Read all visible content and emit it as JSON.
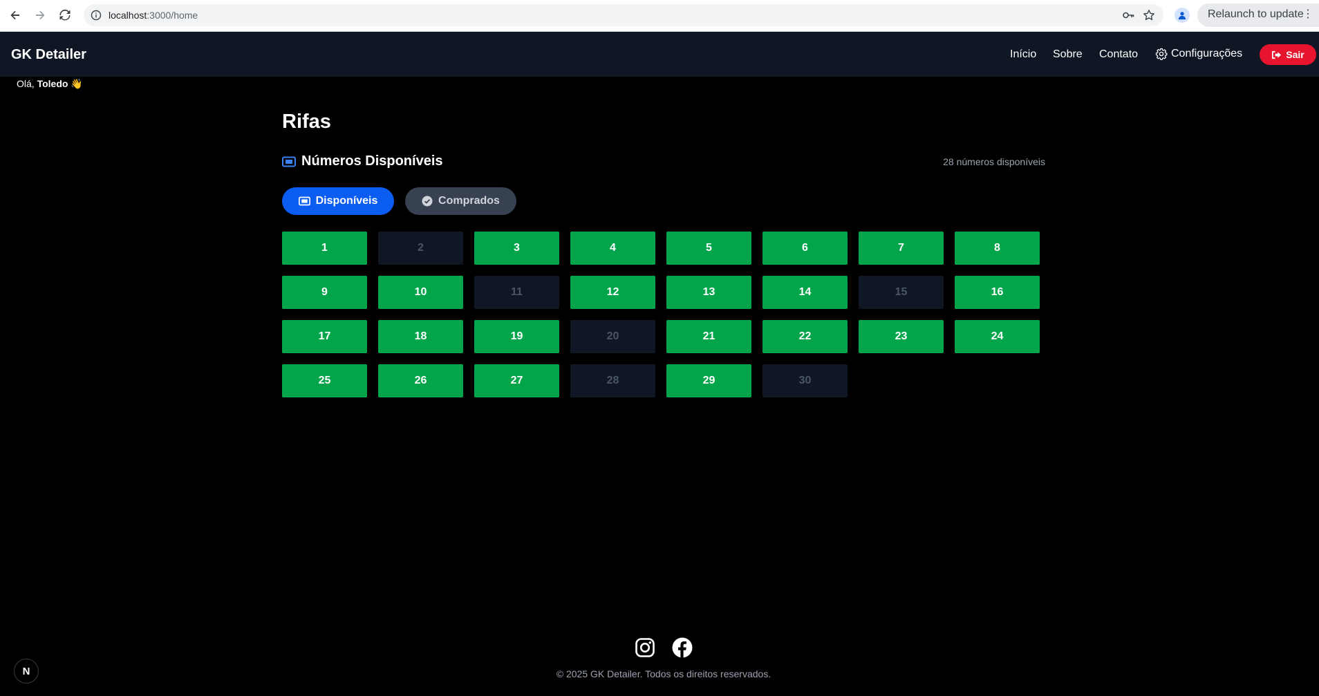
{
  "browser": {
    "url_host": "localhost",
    "url_path": ":3000/home",
    "relaunch_label": "Relaunch to update"
  },
  "header": {
    "brand": "GK Detailer",
    "nav": [
      "Início",
      "Sobre",
      "Contato"
    ],
    "settings_label": "Configurações",
    "logout_label": "Sair"
  },
  "greeting": {
    "prefix": "Olá,",
    "name": "Toledo",
    "emoji": "👋"
  },
  "page": {
    "title": "Rifas",
    "section_title": "Números Disponíveis",
    "count_text": "28 números disponíveis",
    "tabs": {
      "available": "Disponíveis",
      "bought": "Comprados"
    }
  },
  "numbers": [
    {
      "n": "1",
      "status": "available"
    },
    {
      "n": "2",
      "status": "sold"
    },
    {
      "n": "3",
      "status": "available"
    },
    {
      "n": "4",
      "status": "available"
    },
    {
      "n": "5",
      "status": "available"
    },
    {
      "n": "6",
      "status": "available"
    },
    {
      "n": "7",
      "status": "available"
    },
    {
      "n": "8",
      "status": "available"
    },
    {
      "n": "9",
      "status": "available"
    },
    {
      "n": "10",
      "status": "available"
    },
    {
      "n": "11",
      "status": "sold"
    },
    {
      "n": "12",
      "status": "available"
    },
    {
      "n": "13",
      "status": "available"
    },
    {
      "n": "14",
      "status": "available"
    },
    {
      "n": "15",
      "status": "sold"
    },
    {
      "n": "16",
      "status": "available"
    },
    {
      "n": "17",
      "status": "available"
    },
    {
      "n": "18",
      "status": "available"
    },
    {
      "n": "19",
      "status": "available"
    },
    {
      "n": "20",
      "status": "sold"
    },
    {
      "n": "21",
      "status": "available"
    },
    {
      "n": "22",
      "status": "available"
    },
    {
      "n": "23",
      "status": "available"
    },
    {
      "n": "24",
      "status": "available"
    },
    {
      "n": "25",
      "status": "available"
    },
    {
      "n": "26",
      "status": "available"
    },
    {
      "n": "27",
      "status": "available"
    },
    {
      "n": "28",
      "status": "sold"
    },
    {
      "n": "29",
      "status": "available"
    },
    {
      "n": "30",
      "status": "sold"
    }
  ],
  "footer": {
    "copyright": "© 2025 GK Detailer. Todos os direitos reservados.",
    "icons": [
      "instagram-icon",
      "facebook-icon"
    ]
  },
  "dev_badge": "N",
  "colors": {
    "available": "#02a54a",
    "sold": "#0f1724",
    "primary": "#0b5cf0",
    "logout": "#e6142d",
    "header": "#0f1724"
  }
}
